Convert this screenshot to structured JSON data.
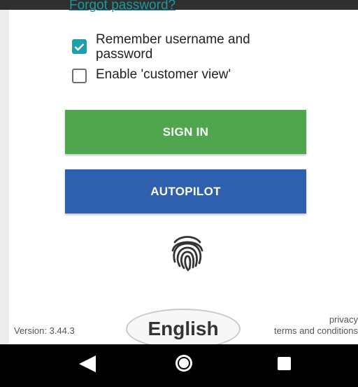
{
  "login": {
    "forgot_password": "Forgot password?",
    "remember_label": "Remember username and password",
    "remember_checked": true,
    "customer_view_label": "Enable 'customer view'",
    "customer_view_checked": false,
    "signin_label": "SIGN IN",
    "autopilot_label": "AUTOPILOT",
    "fingerprint_icon": "fingerprint-icon"
  },
  "footer": {
    "version": "Version: 3.44.3",
    "language": "English",
    "privacy": "privacy",
    "terms": "terms and conditions"
  },
  "navbar": {
    "back_icon": "back-triangle-icon",
    "home_icon": "home-circle-icon",
    "recents_icon": "recents-square-icon"
  },
  "colors": {
    "signin": "#4fa64f",
    "autopilot": "#2f5faf",
    "accent": "#1f9faa"
  }
}
